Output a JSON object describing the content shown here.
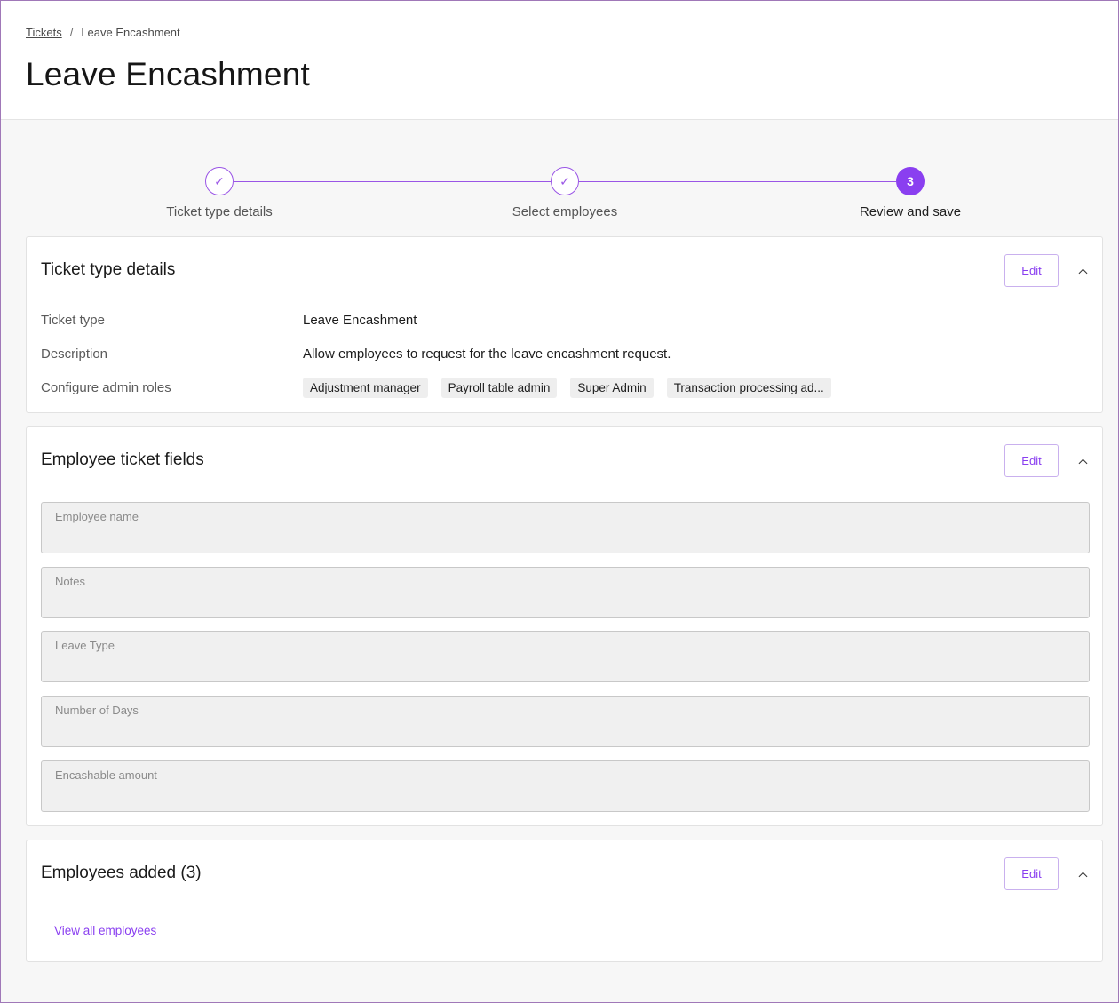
{
  "breadcrumb": {
    "parent": "Tickets",
    "separator": "/",
    "current": "Leave Encashment"
  },
  "page_title": "Leave Encashment",
  "stepper": {
    "steps": [
      {
        "label": "Ticket type details",
        "status": "done",
        "marker": "✓"
      },
      {
        "label": "Select employees",
        "status": "done",
        "marker": "✓"
      },
      {
        "label": "Review and save",
        "status": "current",
        "marker": "3"
      }
    ]
  },
  "ticket_details": {
    "title": "Ticket type details",
    "edit_label": "Edit",
    "rows": [
      {
        "label": "Ticket type",
        "value": "Leave Encashment"
      },
      {
        "label": "Description",
        "value": "Allow employees to request for the leave encashment request."
      },
      {
        "label": "Configure admin roles"
      }
    ],
    "admin_roles": [
      "Adjustment manager",
      "Payroll table admin",
      "Super Admin",
      "Transaction processing ad..."
    ]
  },
  "ticket_fields": {
    "title": "Employee ticket fields",
    "edit_label": "Edit",
    "fields": [
      "Employee name",
      "Notes",
      "Leave Type",
      "Number of Days",
      "Encashable amount"
    ]
  },
  "employees": {
    "title": "Employees added (3)",
    "edit_label": "Edit",
    "view_all": "View all employees"
  },
  "colors": {
    "accent": "#8a3ff0",
    "border": "#a078b8"
  }
}
